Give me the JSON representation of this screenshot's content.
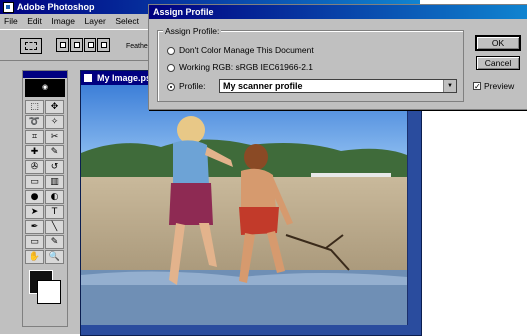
{
  "app": {
    "title": "Adobe Photoshop",
    "menu": [
      "File",
      "Edit",
      "Image",
      "Layer",
      "Select"
    ]
  },
  "options_bar": {
    "feather_label": "Feathe"
  },
  "document": {
    "title": "My Image.ps"
  },
  "dialog": {
    "title": "Assign Profile",
    "group_label": "Assign Profile:",
    "options": [
      {
        "label": "Don't Color Manage This Document",
        "selected": false
      },
      {
        "label": "Working RGB:  sRGB IEC61966-2.1",
        "selected": false
      },
      {
        "label": "Profile:",
        "selected": true
      }
    ],
    "profile_value": "My scanner profile",
    "buttons": {
      "ok": "OK",
      "cancel": "Cancel"
    },
    "preview": {
      "label": "Preview",
      "checked": true
    }
  },
  "toolbox": {
    "tools": [
      "marquee-tool",
      "move-tool",
      "lasso-tool",
      "magic-wand-tool",
      "crop-tool",
      "slice-tool",
      "healing-brush-tool",
      "brush-tool",
      "clone-stamp-tool",
      "history-brush-tool",
      "eraser-tool",
      "gradient-tool",
      "blur-tool",
      "dodge-tool",
      "path-selection-tool",
      "type-tool",
      "pen-tool",
      "line-tool",
      "notes-tool",
      "eyedropper-tool",
      "hand-tool",
      "zoom-tool"
    ],
    "glyphs": [
      "⬚",
      "✥",
      "➰",
      "✧",
      "⌗",
      "✂",
      "✚",
      "✎",
      "✇",
      "↺",
      "▭",
      "▥",
      "●",
      "◐",
      "➤",
      "T",
      "✒",
      "╲",
      "▭",
      "✎",
      "✋",
      "🔍"
    ],
    "foreground_color": "#111111",
    "background_color": "#ffffff"
  }
}
